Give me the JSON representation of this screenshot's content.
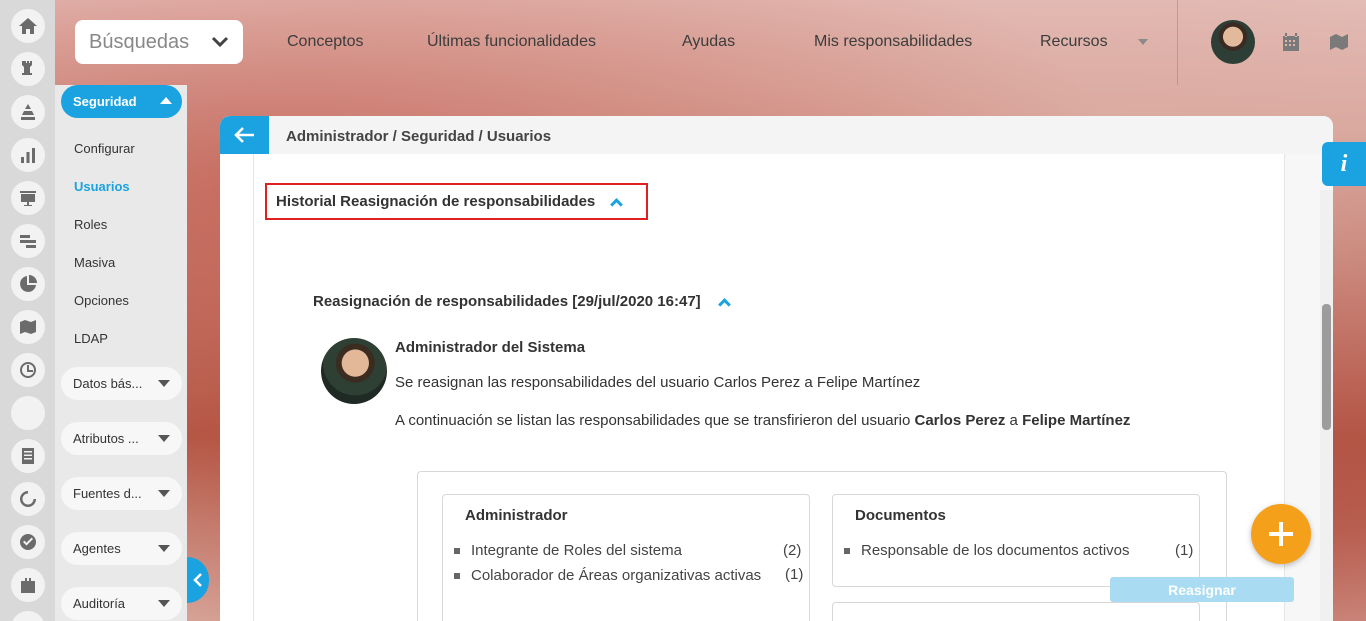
{
  "topbar": {
    "search_label": "Búsquedas",
    "nav": [
      "Conceptos",
      "Últimas funcionalidades",
      "Ayudas",
      "Mis responsabilidades",
      "Recursos"
    ]
  },
  "module": {
    "title": "Seguridad",
    "items": [
      "Configurar",
      "Usuarios",
      "Roles",
      "Masiva",
      "Opciones",
      "LDAP"
    ],
    "active_item": "Usuarios",
    "groups": [
      "Datos bás...",
      "Atributos ...",
      "Fuentes d...",
      "Agentes",
      "Auditoría"
    ]
  },
  "breadcrumb": "Administrador / Seguridad / Usuarios",
  "history": {
    "title": "Historial Reasignación de responsabilidades",
    "section_title": "Reasignación de responsabilidades [29/jul/2020 16:47]",
    "author": "Administrador del Sistema",
    "line1": "Se reasignan las responsabilidades del usuario Carlos Perez a Felipe Martínez",
    "line2_prefix": "A continuación se listan las responsabilidades que se transfirieron del usuario ",
    "line2_from": "Carlos Perez",
    "line2_mid": " a ",
    "line2_to": "Felipe Martínez"
  },
  "categories": [
    {
      "title": "Administrador",
      "items": [
        {
          "label": "Integrante de Roles del sistema",
          "count": "(2)"
        },
        {
          "label": "Colaborador de Áreas organizativas activas",
          "count": "(1)"
        }
      ]
    },
    {
      "title": "Documentos",
      "items": [
        {
          "label": "Responsable de los documentos activos",
          "count": "(1)"
        }
      ]
    }
  ],
  "actions": {
    "reassign_label": "Reasignar",
    "info_label": "i"
  },
  "colors": {
    "accent": "#1aa3e0",
    "fab": "#f5a01a",
    "highlight_border": "#e02020"
  },
  "icons": {
    "rail": [
      "home-icon",
      "chess-icon",
      "pyramid-icon",
      "chart-icon",
      "presentation-icon",
      "bars-icon",
      "pie-icon",
      "map-icon",
      "clock-icon",
      "blank-icon",
      "document-icon",
      "cycle-icon",
      "check-icon",
      "briefcase-icon",
      "more-icon"
    ]
  }
}
